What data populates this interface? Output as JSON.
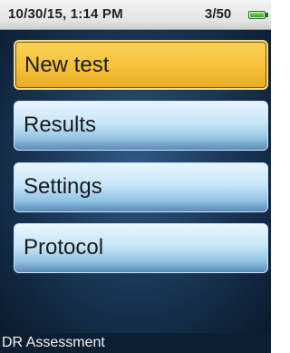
{
  "status_bar": {
    "datetime": "10/30/15, 1:14 PM",
    "record_count": "3/50",
    "battery_icon": "battery-icon",
    "battery_color": "#2fa12a"
  },
  "menu": {
    "items": [
      {
        "label": "New test",
        "selected": true
      },
      {
        "label": "Results",
        "selected": false
      },
      {
        "label": "Settings",
        "selected": false
      },
      {
        "label": "Protocol",
        "selected": false
      }
    ],
    "selected_color": "#f6c23c",
    "normal_color": "#c7e6f8"
  },
  "footer": {
    "title": "DR Assessment"
  },
  "colors": {
    "background": "#1b3a5c",
    "footer_background": "#0b1f33"
  }
}
